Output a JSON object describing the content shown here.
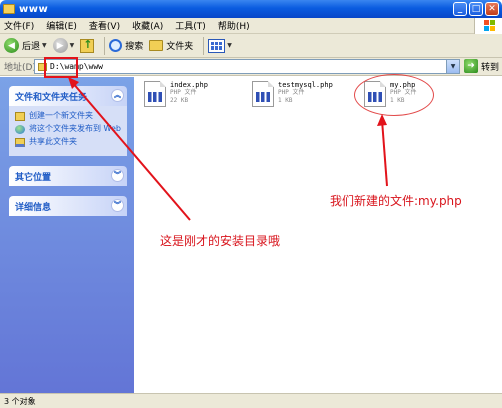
{
  "window": {
    "title": "www"
  },
  "menu": {
    "items": [
      "文件(F)",
      "编辑(E)",
      "查看(V)",
      "收藏(A)",
      "工具(T)",
      "帮助(H)"
    ]
  },
  "toolbar": {
    "back_label": "后退",
    "search_label": "搜索",
    "folders_label": "文件夹"
  },
  "address": {
    "label": "地址(D)",
    "value": "D:\\wamp\\www",
    "go_label": "转到"
  },
  "taskpane": {
    "file_tasks": {
      "title": "文件和文件夹任务",
      "items": [
        "创建一个新文件夹",
        "将这个文件夹发布到 Web",
        "共享此文件夹"
      ]
    },
    "other_places": {
      "title": "其它位置"
    },
    "details": {
      "title": "详细信息"
    }
  },
  "files": [
    {
      "name": "index.php",
      "type": "PHP 文件",
      "size": "22 KB"
    },
    {
      "name": "testmysql.php",
      "type": "PHP 文件",
      "size": "1 KB"
    },
    {
      "name": "my.php",
      "type": "PHP 文件",
      "size": "1 KB"
    }
  ],
  "annotations": {
    "new_file_note": "我们新建的文件:my.php",
    "install_dir_note": "这是刚才的安装目录哦"
  },
  "status": {
    "text": "3 个对象"
  },
  "colors": {
    "title_blue": "#0a5ce0",
    "annotation_red": "#d8141c"
  }
}
